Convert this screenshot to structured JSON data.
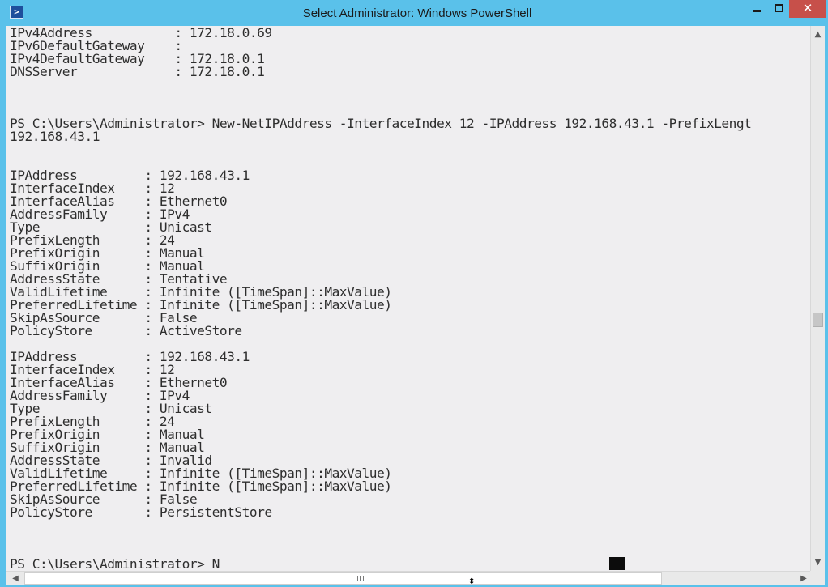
{
  "window": {
    "title": "Select Administrator: Windows PowerShell",
    "icon": "powershell-icon",
    "icon_glyph": ">",
    "controls": {
      "minimize_icon": "minimize-icon",
      "maximize_icon": "maximize-icon",
      "close_icon": "close-icon",
      "close_glyph": "✕"
    },
    "colors": {
      "titlebar": "#5ac1ea",
      "close_button": "#c7504a",
      "console_bg": "#efeef0",
      "console_text": "#2e2e2e",
      "cursor": "#0c0c0c"
    }
  },
  "console": {
    "lines": [
      "IPv4Address           : 172.18.0.69",
      "IPv6DefaultGateway    :",
      "IPv4DefaultGateway    : 172.18.0.1",
      "DNSServer             : 172.18.0.1",
      "",
      "",
      "",
      "PS C:\\Users\\Administrator> New-NetIPAddress -InterfaceIndex 12 -IPAddress 192.168.43.1 -PrefixLengt",
      "192.168.43.1",
      "",
      "",
      "IPAddress         : 192.168.43.1",
      "InterfaceIndex    : 12",
      "InterfaceAlias    : Ethernet0",
      "AddressFamily     : IPv4",
      "Type              : Unicast",
      "PrefixLength      : 24",
      "PrefixOrigin      : Manual",
      "SuffixOrigin      : Manual",
      "AddressState      : Tentative",
      "ValidLifetime     : Infinite ([TimeSpan]::MaxValue)",
      "PreferredLifetime : Infinite ([TimeSpan]::MaxValue)",
      "SkipAsSource      : False",
      "PolicyStore       : ActiveStore",
      "",
      "IPAddress         : 192.168.43.1",
      "InterfaceIndex    : 12",
      "InterfaceAlias    : Ethernet0",
      "AddressFamily     : IPv4",
      "Type              : Unicast",
      "PrefixLength      : 24",
      "PrefixOrigin      : Manual",
      "SuffixOrigin      : Manual",
      "AddressState      : Invalid",
      "ValidLifetime     : Infinite ([TimeSpan]::MaxValue)",
      "PreferredLifetime : Infinite ([TimeSpan]::MaxValue)",
      "SkipAsSource      : False",
      "PolicyStore       : PersistentStore",
      "",
      "",
      "",
      "PS C:\\Users\\Administrator> N"
    ]
  },
  "scrollbars": {
    "vertical": {
      "up_icon": "scroll-up-arrow-icon",
      "down_icon": "scroll-down-arrow-icon",
      "up_glyph": "▲",
      "down_glyph": "▼"
    },
    "horizontal": {
      "left_icon": "scroll-left-arrow-icon",
      "right_icon": "scroll-right-arrow-icon",
      "left_glyph": "◀",
      "right_glyph": "▶"
    }
  },
  "pointer_icon": "mouse-pointer-icon",
  "pointer_glyph": "⬍"
}
